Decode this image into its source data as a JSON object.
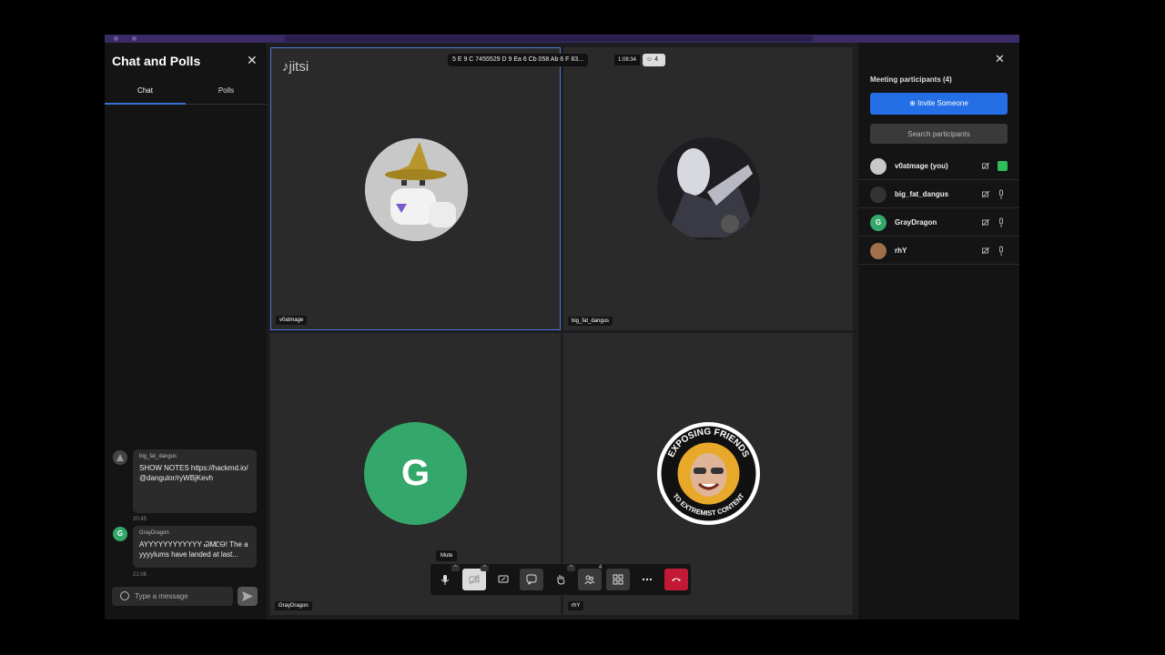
{
  "chat": {
    "title": "Chat and Polls",
    "tabs": [
      {
        "label": "Chat"
      },
      {
        "label": "Polls"
      }
    ],
    "messages": [
      {
        "sender": "big_fat_dangus",
        "text": "SHOW NOTES https://hackmd.io/@dangulor/ryWBjKevh",
        "time": "20:45"
      },
      {
        "sender": "GrayDragon",
        "text": "AYYYYYYYYYYYY ᏊᎷᏝᎾ! The ayyyylums have landed at last...",
        "time": "21:06",
        "avatar_letter": "G"
      }
    ],
    "composer_placeholder": "Type a message"
  },
  "meeting": {
    "logo_text": "jitsi",
    "room_id": "5 E 9 C 7455529 D 9 Ea 6 Cb 058 Ab 6 F 83...",
    "timer": "1:08:34",
    "participant_count": "4"
  },
  "tiles": [
    {
      "name": "v0atmage"
    },
    {
      "name": "big_fat_dangus"
    },
    {
      "name": "GrayDragon",
      "avatar_letter": "G"
    },
    {
      "name": "rhY",
      "badge_top": "EXPOSING FRIENDS",
      "badge_bottom": "TO EXTREMIST CONTENT"
    }
  ],
  "toolbar": {
    "tooltip": "Mute",
    "participants_badge": "4"
  },
  "participants": {
    "title": "Meeting participants (4)",
    "invite_label": "Invite Someone",
    "search_placeholder": "Search participants",
    "list": [
      {
        "name": "v0atmage (you)"
      },
      {
        "name": "big_fat_dangus"
      },
      {
        "name": "GrayDragon",
        "avatar_letter": "G"
      },
      {
        "name": "rhY"
      }
    ]
  },
  "colors": {
    "accent": "#246fe5",
    "green": "#2ebd5a",
    "hangup": "#c21a34",
    "gray_dragon": "#34a86a"
  }
}
